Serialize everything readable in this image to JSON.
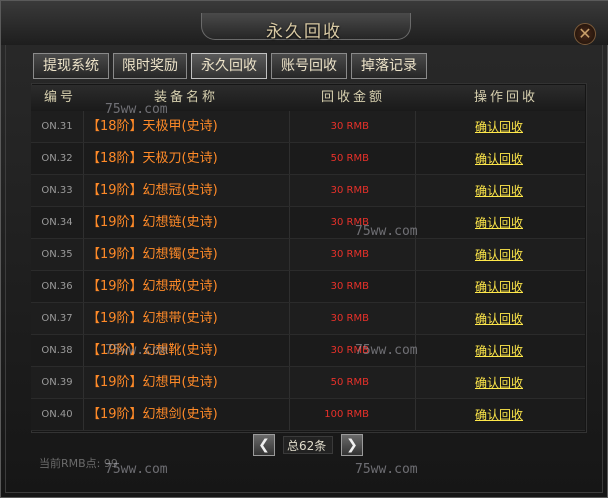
{
  "window": {
    "title": "永久回收",
    "close_glyph": "✕"
  },
  "tabs": [
    {
      "label": "提现系统",
      "active": false
    },
    {
      "label": "限时奖励",
      "active": false
    },
    {
      "label": "永久回收",
      "active": true
    },
    {
      "label": "账号回收",
      "active": false
    },
    {
      "label": "掉落记录",
      "active": false
    }
  ],
  "table": {
    "columns": [
      "编号",
      "装备名称",
      "回收金额",
      "操作回收"
    ],
    "rows": [
      {
        "no": "ON.31",
        "name": "【18阶】天极甲(史诗)",
        "price": "30 RMB",
        "action": "确认回收"
      },
      {
        "no": "ON.32",
        "name": "【18阶】天极刀(史诗)",
        "price": "50 RMB",
        "action": "确认回收"
      },
      {
        "no": "ON.33",
        "name": "【19阶】幻想冠(史诗)",
        "price": "30 RMB",
        "action": "确认回收"
      },
      {
        "no": "ON.34",
        "name": "【19阶】幻想链(史诗)",
        "price": "30 RMB",
        "action": "确认回收"
      },
      {
        "no": "ON.35",
        "name": "【19阶】幻想镯(史诗)",
        "price": "30 RMB",
        "action": "确认回收"
      },
      {
        "no": "ON.36",
        "name": "【19阶】幻想戒(史诗)",
        "price": "30 RMB",
        "action": "确认回收"
      },
      {
        "no": "ON.37",
        "name": "【19阶】幻想带(史诗)",
        "price": "30 RMB",
        "action": "确认回收"
      },
      {
        "no": "ON.38",
        "name": "【19阶】幻想靴(史诗)",
        "price": "30 RMB",
        "action": "确认回收"
      },
      {
        "no": "ON.39",
        "name": "【19阶】幻想甲(史诗)",
        "price": "50 RMB",
        "action": "确认回收"
      },
      {
        "no": "ON.40",
        "name": "【19阶】幻想剑(史诗)",
        "price": "100 RMB",
        "action": "确认回收"
      }
    ]
  },
  "pager": {
    "prev_glyph": "❮",
    "next_glyph": "❯",
    "total": "总62条"
  },
  "status": {
    "points": "当前RMB点: 99"
  },
  "watermark": {
    "text": "75ww.com"
  },
  "colors": {
    "item_name": "#ff8a28",
    "price": "#e8312a",
    "action_link": "#ffe84a"
  }
}
